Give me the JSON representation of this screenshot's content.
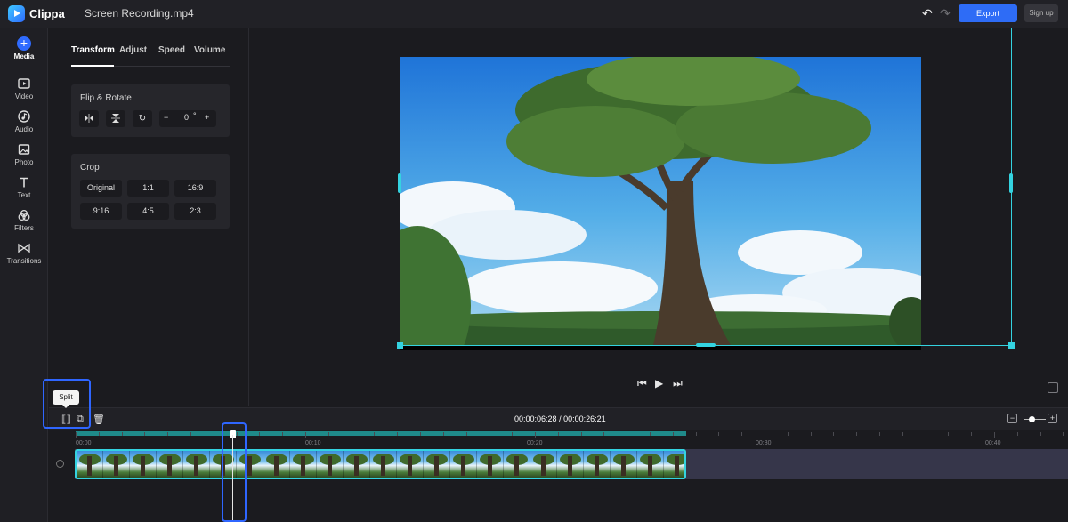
{
  "app": {
    "name": "Clippa",
    "file_name": "Screen Recording.mp4"
  },
  "header": {
    "export_label": "Export",
    "signup_label": "Sign up",
    "undo_icon": "undo-icon",
    "redo_icon": "redo-icon"
  },
  "rail": {
    "items": [
      {
        "label": "Media",
        "icon": "plus-circle-icon",
        "active": true
      },
      {
        "label": "Video",
        "icon": "video-icon"
      },
      {
        "label": "Audio",
        "icon": "audio-icon"
      },
      {
        "label": "Photo",
        "icon": "photo-icon"
      },
      {
        "label": "Text",
        "icon": "text-icon"
      },
      {
        "label": "Filters",
        "icon": "filters-icon"
      },
      {
        "label": "Transitions",
        "icon": "transitions-icon"
      }
    ]
  },
  "panel": {
    "tabs": [
      "Transform",
      "Adjust",
      "Speed",
      "Volume"
    ],
    "active_tab": "Transform",
    "flip_rotate": {
      "title": "Flip & Rotate",
      "rotation_value": "0",
      "degree_symbol": "°"
    },
    "crop": {
      "title": "Crop",
      "options": [
        "Original",
        "1:1",
        "16:9",
        "9:16",
        "4:5",
        "2:3"
      ]
    }
  },
  "timeline": {
    "current_time": "00:00:06:28",
    "separator": "/",
    "total_time": "00:00:26:21",
    "tooltip": "Split",
    "ruler": [
      "00:00",
      "00:10",
      "00:20",
      "00:30",
      "00:40"
    ],
    "playhead_fraction": 0.2622,
    "zoom_level": 0.5
  },
  "colors": {
    "accent": "#2e6cf6",
    "selection": "#34d3e0",
    "progress": "#1f8a8a"
  }
}
